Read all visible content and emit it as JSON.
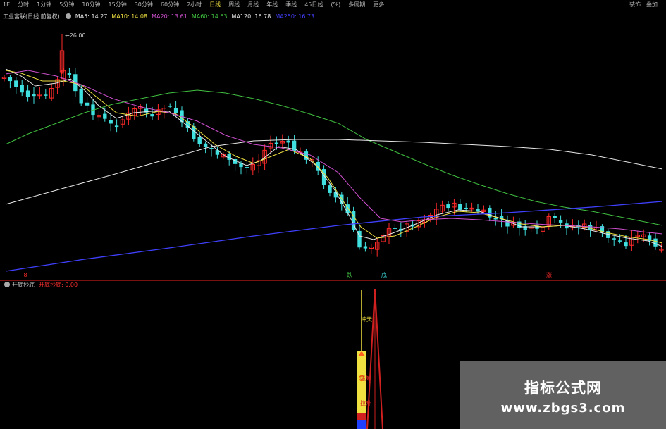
{
  "toolbar": {
    "periods": [
      {
        "label": "1E",
        "active": false
      },
      {
        "label": "分时",
        "active": false
      },
      {
        "label": "1分钟",
        "active": false
      },
      {
        "label": "5分钟",
        "active": false
      },
      {
        "label": "10分钟",
        "active": false
      },
      {
        "label": "15分钟",
        "active": false
      },
      {
        "label": "30分钟",
        "active": false
      },
      {
        "label": "60分钟",
        "active": false
      },
      {
        "label": "2小时",
        "active": false
      },
      {
        "label": "日线",
        "active": true
      },
      {
        "label": "周线",
        "active": false
      },
      {
        "label": "月线",
        "active": false
      },
      {
        "label": "年线",
        "active": false
      },
      {
        "label": "季线",
        "active": false
      },
      {
        "label": "45日线",
        "active": false
      },
      {
        "label": "(%)",
        "active": false
      },
      {
        "label": "多周期",
        "active": false
      },
      {
        "label": "更多",
        "active": false
      }
    ],
    "right_labels": [
      "装饰",
      "叠加"
    ]
  },
  "chart_header": {
    "title": "工业富联(日线 前复权)",
    "ma_items": [
      {
        "label": "MA5: 14.27",
        "color": "#e8e8e8"
      },
      {
        "label": "MA10: 14.08",
        "color": "#f0e040"
      },
      {
        "label": "MA20: 13.61",
        "color": "#d050d0"
      },
      {
        "label": "MA60: 14.63",
        "color": "#40c040"
      },
      {
        "label": "MA120: 16.78",
        "color": "#e8e8e8"
      },
      {
        "label": "MA250: 16.73",
        "color": "#4040ff"
      }
    ]
  },
  "indicator_header": {
    "name": "开底抄底",
    "value_text": "开底抄底: 0.00"
  },
  "chart_data": {
    "type": "candlestick",
    "price_labels": {
      "high": "26.00"
    },
    "signal_labels": [
      "8",
      "跌",
      "底",
      "涨"
    ],
    "indicator_labels": [
      "冲天",
      "吸筹",
      "拉升"
    ]
  },
  "colors": {
    "up": "#ff2a2a",
    "down": "#40e0e0",
    "ma5": "#e8e8e8",
    "ma10": "#f0e040",
    "ma20": "#d050d0",
    "ma60": "#40c040",
    "ma120": "#e8e8e8",
    "ma250": "#4040ff"
  },
  "watermark": {
    "line1": "指标公式网",
    "line2": "www.zbgs3.com"
  }
}
